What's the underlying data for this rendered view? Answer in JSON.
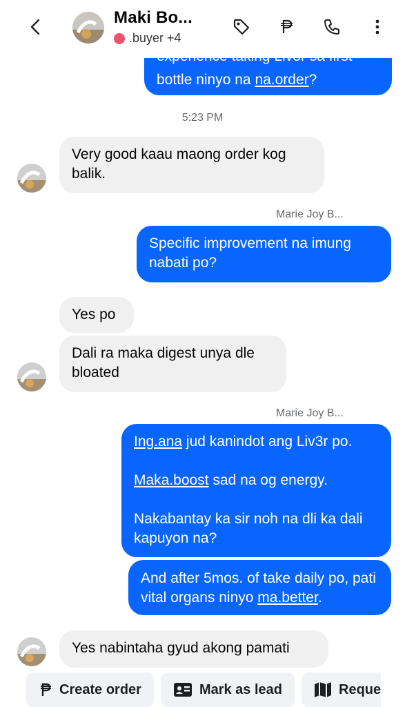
{
  "header": {
    "name": "Maki Bo...",
    "subtitle": ".buyer +4"
  },
  "messages": {
    "m1_line1": "experience taking Liv3r sa first",
    "m1_line2_pre": "bottle ninyo na ",
    "m1_line2_link": "na.order",
    "m1_line2_post": "?",
    "time": "5:23 PM",
    "m2": "Very good kaau maong order kog balik.",
    "sender1": "Marie Joy B...",
    "m3": "Specific improvement na imung nabati po?",
    "m4": "Yes po",
    "m5": "Dali ra maka digest unya dle bloated",
    "sender2": "Marie Joy B...",
    "m6_link": "Ing.ana",
    "m6_text": " jud kanindot ang Liv3r po.",
    "m6_link2": "Maka.boost",
    "m6_text2": " sad na og energy.",
    "m6_text3": "Nakabantay ka sir noh na dli ka dali kapuyon na?",
    "m7_pre": "And after 5mos. of take daily po, pati vital organs ninyo ",
    "m7_link": "ma.better",
    "m7_post": ".",
    "m8": "Yes nabintaha gyud akong pamati"
  },
  "actions": {
    "create_order": "Create order",
    "mark_as_lead": "Mark as lead",
    "request": "Reque"
  },
  "colors": {
    "outgoing": "#0866ff",
    "incoming": "#f0f0f0",
    "status_dot": "#f0506e"
  }
}
